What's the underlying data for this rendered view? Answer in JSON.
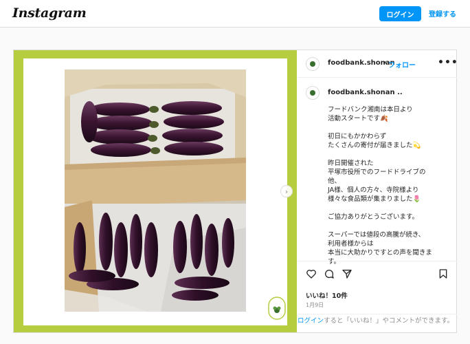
{
  "header": {
    "logo_text": "Instagram",
    "login_label": "ログイン",
    "signup_label": "登録する"
  },
  "post": {
    "username": "foodbank.shonan",
    "separator": "•",
    "follow_label": "フォロー",
    "more_label": "•••",
    "next_label": "›",
    "caption_user": "foodbank.shonan ..",
    "caption_paragraphs": [
      [
        "フードバンク湘南は本日より",
        "活動スタートです🍂"
      ],
      [
        "初日にもかかわらず",
        "たくさんの寄付が届きました💫"
      ],
      [
        "昨日開催された",
        "平塚市役所でのフードドライブの",
        "他、",
        "JA様、個人の方々、寺院様より",
        "様々な食品類が集まりました🌷"
      ],
      [
        "ご協力ありがとうございます。"
      ],
      [
        "スーパーでは値段の高騰が続き、",
        "利用者様からは",
        "本当に大助かりですとの声を聞きま",
        "す。"
      ]
    ],
    "likes_text": "いいね！10件",
    "date_text": "1月9日",
    "login_prompt_link": "ログイン",
    "login_prompt_rest": "すると「いいね！」やコメントができます。",
    "badge_text": "フードバンク湘南"
  },
  "colors": {
    "frame_green": "#b5cd3f",
    "accent_blue": "#0095f6"
  }
}
